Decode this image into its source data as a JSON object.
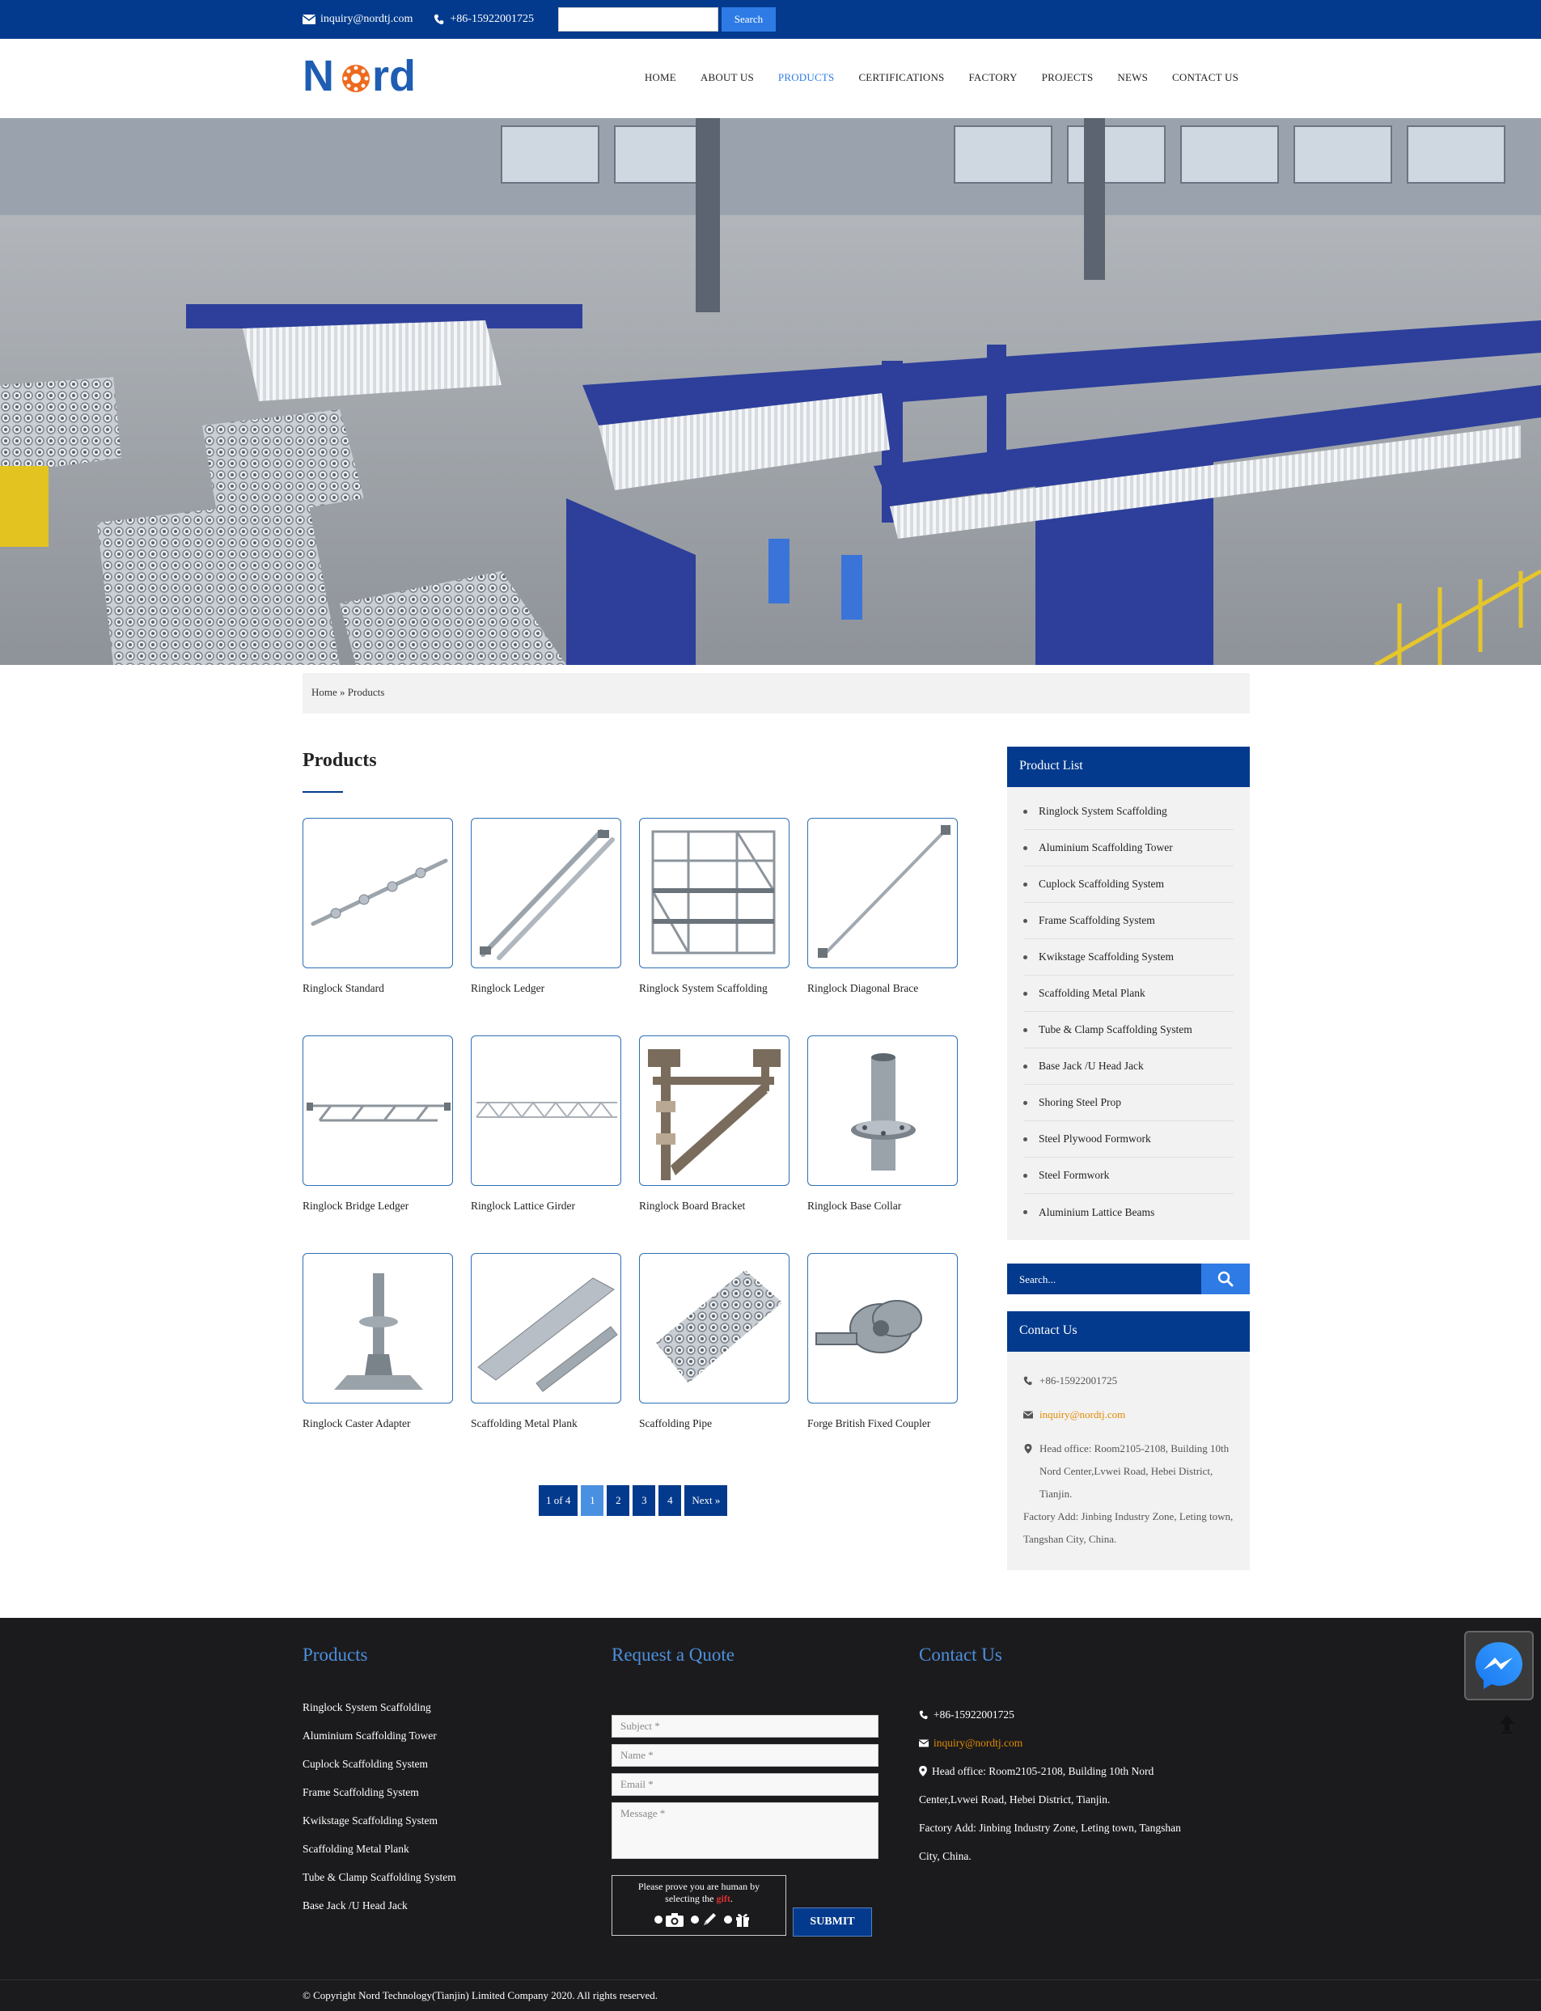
{
  "topbar": {
    "email": "inquiry@nordtj.com",
    "phone": "+86-15922001725",
    "search_placeholder": "",
    "search_button": "Search"
  },
  "header": {
    "logo_text": "Nord",
    "nav": [
      {
        "label": "HOME"
      },
      {
        "label": "ABOUT US"
      },
      {
        "label": "PRODUCTS",
        "active": true
      },
      {
        "label": "CERTIFICATIONS"
      },
      {
        "label": "FACTORY"
      },
      {
        "label": "PROJECTS"
      },
      {
        "label": "NEWS"
      },
      {
        "label": "CONTACT US"
      }
    ]
  },
  "breadcrumb": {
    "home": "Home",
    "sep": "»",
    "current": "Products"
  },
  "main": {
    "title": "Products",
    "products": [
      {
        "name": "Ringlock Standard",
        "icon": "ringlock-standard"
      },
      {
        "name": "Ringlock Ledger",
        "icon": "ringlock-ledger"
      },
      {
        "name": "Ringlock System Scaffolding",
        "icon": "scaffold-tower"
      },
      {
        "name": "Ringlock Diagonal Brace",
        "icon": "diagonal-brace"
      },
      {
        "name": "Ringlock Bridge Ledger",
        "icon": "bridge-ledger"
      },
      {
        "name": "Ringlock Lattice Girder",
        "icon": "lattice-girder"
      },
      {
        "name": "Ringlock Board Bracket",
        "icon": "board-bracket"
      },
      {
        "name": "Ringlock Base Collar",
        "icon": "base-collar"
      },
      {
        "name": "Ringlock Caster Adapter",
        "icon": "caster-adapter"
      },
      {
        "name": "Scaffolding Metal Plank",
        "icon": "metal-plank"
      },
      {
        "name": "Scaffolding Pipe",
        "icon": "pipe-bundle"
      },
      {
        "name": "Forge British Fixed Coupler",
        "icon": "coupler"
      }
    ],
    "pagination": {
      "summary": "1 of 4",
      "pages": [
        "1",
        "2",
        "3",
        "4"
      ],
      "current": "1",
      "next": "Next »"
    }
  },
  "sidebar": {
    "product_list_title": "Product List",
    "product_list": [
      "Ringlock System Scaffolding",
      "Aluminium Scaffolding Tower",
      "Cuplock Scaffolding System",
      "Frame Scaffolding System",
      "Kwikstage Scaffolding System",
      "Scaffolding Metal Plank",
      "Tube & Clamp Scaffolding System",
      "Base Jack /U Head Jack",
      "Shoring Steel Prop",
      "Steel Plywood Formwork",
      "Steel Formwork",
      "Aluminium Lattice Beams"
    ],
    "search_placeholder": "Search...",
    "contact_title": "Contact Us",
    "contact": {
      "phone": "+86-15922001725",
      "email": "inquiry@nordtj.com",
      "head_office": "Head office: Room2105-2108, Building 10th Nord Center,Lvwei Road, Hebei District, Tianjin.",
      "factory": "Factory Add: Jinbing Industry Zone, Leting town, Tangshan City, China."
    }
  },
  "footer": {
    "products_title": "Products",
    "products": [
      "Ringlock System Scaffolding",
      "Aluminium Scaffolding Tower",
      "Cuplock Scaffolding System",
      "Frame Scaffolding System",
      "Kwikstage Scaffolding System",
      "Scaffolding Metal Plank",
      "Tube & Clamp Scaffolding System",
      "Base Jack /U Head Jack"
    ],
    "quote_title": "Request a Quote",
    "form": {
      "subject": "Subject *",
      "name": "Name *",
      "email": "Email *",
      "message": "Message *",
      "captcha_line1": "Please prove you are human by",
      "captcha_line2a": "selecting the",
      "captcha_gift": "gift",
      "captcha_line2b": ".",
      "submit": "SUBMIT"
    },
    "contact_title": "Contact Us",
    "contact": {
      "phone": "+86-15922001725",
      "email": "inquiry@nordtj.com",
      "head_office_1": "Head office: Room2105-2108, Building 10th Nord",
      "head_office_2": "Center,Lvwei Road, Hebei District, Tianjin.",
      "factory_1": "Factory Add: Jinbing Industry Zone, Leting town, Tangshan",
      "factory_2": "City, China."
    },
    "copyright": "© Copyright Nord Technology(Tianjin) Limited Company 2020. All rights reserved."
  },
  "colors": {
    "brand_blue": "#033a8d",
    "accent_blue": "#2e7be5",
    "footer_bg": "#1b1b1d",
    "link_orange": "#e08a00"
  }
}
